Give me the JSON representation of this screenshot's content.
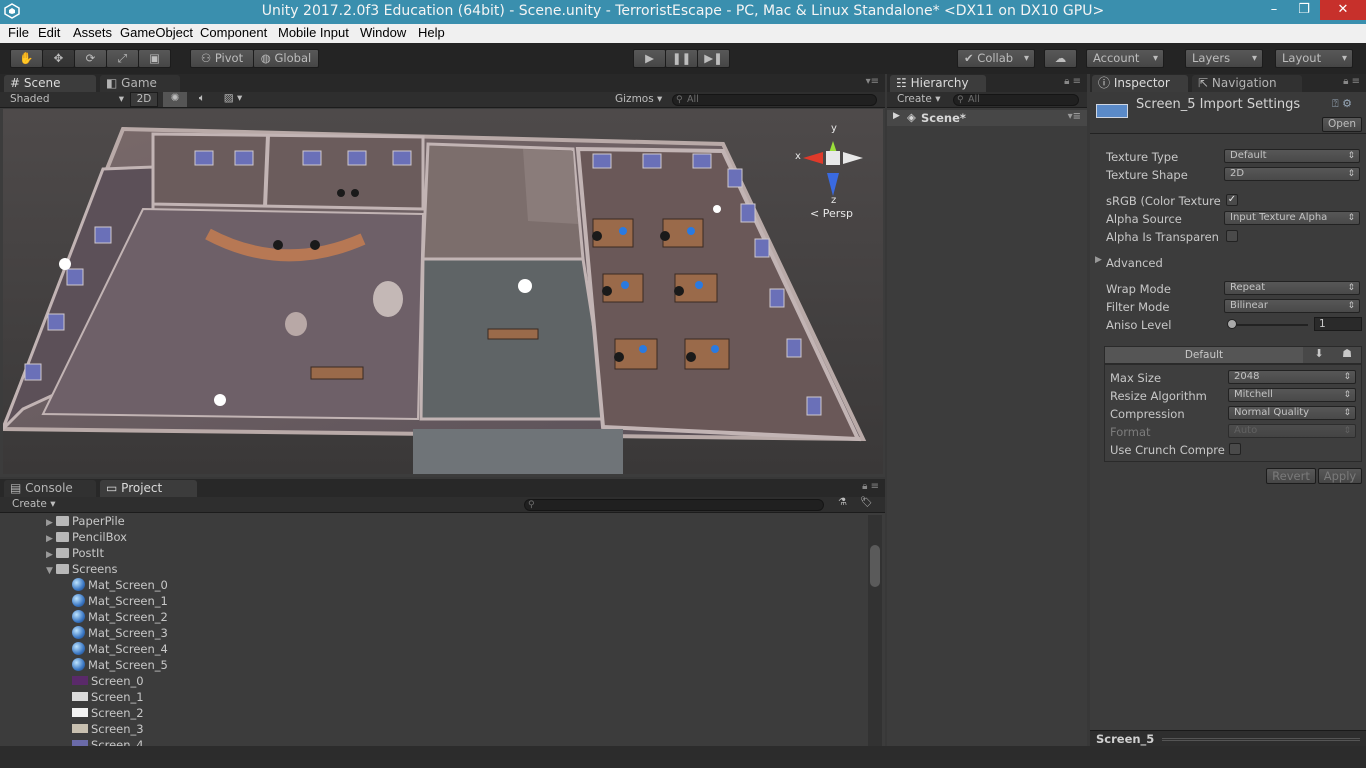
{
  "window": {
    "title": "Unity 2017.2.0f3 Education (64bit) - Scene.unity - TerroristEscape - PC, Mac & Linux Standalone* <DX11 on DX10 GPU>",
    "minimize": "–",
    "maximize": "❐",
    "close": "✕"
  },
  "menu": [
    "File",
    "Edit",
    "Assets",
    "GameObject",
    "Component",
    "Mobile Input",
    "Window",
    "Help"
  ],
  "toolbar": {
    "pivot": "Pivot",
    "global": "Global",
    "collab": "Collab",
    "account": "Account",
    "layers": "Layers",
    "layout": "Layout"
  },
  "scene_panel": {
    "tab_scene": "Scene",
    "tab_game": "Game",
    "shading": "Shaded",
    "mode_2d": "2D",
    "gizmos": "Gizmos",
    "search_placeholder": "All",
    "persp_label": "Persp",
    "axis_x": "x",
    "axis_y": "y",
    "axis_z": "z"
  },
  "hierarchy": {
    "tab": "Hierarchy",
    "create": "Create",
    "search_placeholder": "All",
    "scene_name": "Scene*"
  },
  "inspector": {
    "tab_inspector": "Inspector",
    "tab_navigation": "Navigation",
    "asset_title": "Screen_5 Import Settings",
    "open_button": "Open",
    "texture_type_label": "Texture Type",
    "texture_type_value": "Default",
    "texture_shape_label": "Texture Shape",
    "texture_shape_value": "2D",
    "srgb_label": "sRGB (Color Texture",
    "srgb_checked": "✓",
    "alpha_source_label": "Alpha Source",
    "alpha_source_value": "Input Texture Alpha",
    "alpha_transparency_label": "Alpha Is Transparen",
    "advanced_label": "Advanced",
    "wrap_mode_label": "Wrap Mode",
    "wrap_mode_value": "Repeat",
    "filter_mode_label": "Filter Mode",
    "filter_mode_value": "Bilinear",
    "aniso_label": "Aniso Level",
    "aniso_value": "1",
    "aniso_level_fraction": 0.0,
    "platform_tab": "Default",
    "max_size_label": "Max Size",
    "max_size_value": "2048",
    "resize_label": "Resize Algorithm",
    "resize_value": "Mitchell",
    "compression_label": "Compression",
    "compression_value": "Normal Quality",
    "format_label": "Format",
    "format_value": "Auto",
    "crunch_label": "Use Crunch Compre",
    "revert_button": "Revert",
    "apply_button": "Apply",
    "preview_title": "Screen_5"
  },
  "console_tab": "Console",
  "project_tab": "Project",
  "project_create": "Create",
  "project_tree": [
    {
      "name": "PaperPile",
      "kind": "folder",
      "depth": 0,
      "expanded": false
    },
    {
      "name": "PencilBox",
      "kind": "folder",
      "depth": 0,
      "expanded": false
    },
    {
      "name": "PostIt",
      "kind": "folder",
      "depth": 0,
      "expanded": false
    },
    {
      "name": "Screens",
      "kind": "folder",
      "depth": 0,
      "expanded": true
    },
    {
      "name": "Mat_Screen_0",
      "kind": "material",
      "depth": 1
    },
    {
      "name": "Mat_Screen_1",
      "kind": "material",
      "depth": 1
    },
    {
      "name": "Mat_Screen_2",
      "kind": "material",
      "depth": 1
    },
    {
      "name": "Mat_Screen_3",
      "kind": "material",
      "depth": 1
    },
    {
      "name": "Mat_Screen_4",
      "kind": "material",
      "depth": 1
    },
    {
      "name": "Mat_Screen_5",
      "kind": "material",
      "depth": 1
    },
    {
      "name": "Screen_0",
      "kind": "texture",
      "depth": 1,
      "swatch": "#5a2a6a"
    },
    {
      "name": "Screen_1",
      "kind": "texture",
      "depth": 1,
      "swatch": "#dcdcdc"
    },
    {
      "name": "Screen_2",
      "kind": "texture",
      "depth": 1,
      "swatch": "#f2f2f2"
    },
    {
      "name": "Screen_3",
      "kind": "texture",
      "depth": 1,
      "swatch": "#c8c0b0"
    },
    {
      "name": "Screen_4",
      "kind": "texture",
      "depth": 1,
      "swatch": "#6a6aa8"
    }
  ],
  "colors": {
    "titlebar": "#3a8fae",
    "close": "#c7302b",
    "axis_x": "#e03a2a",
    "axis_y": "#9ade3a",
    "axis_z": "#3a6ae0"
  }
}
